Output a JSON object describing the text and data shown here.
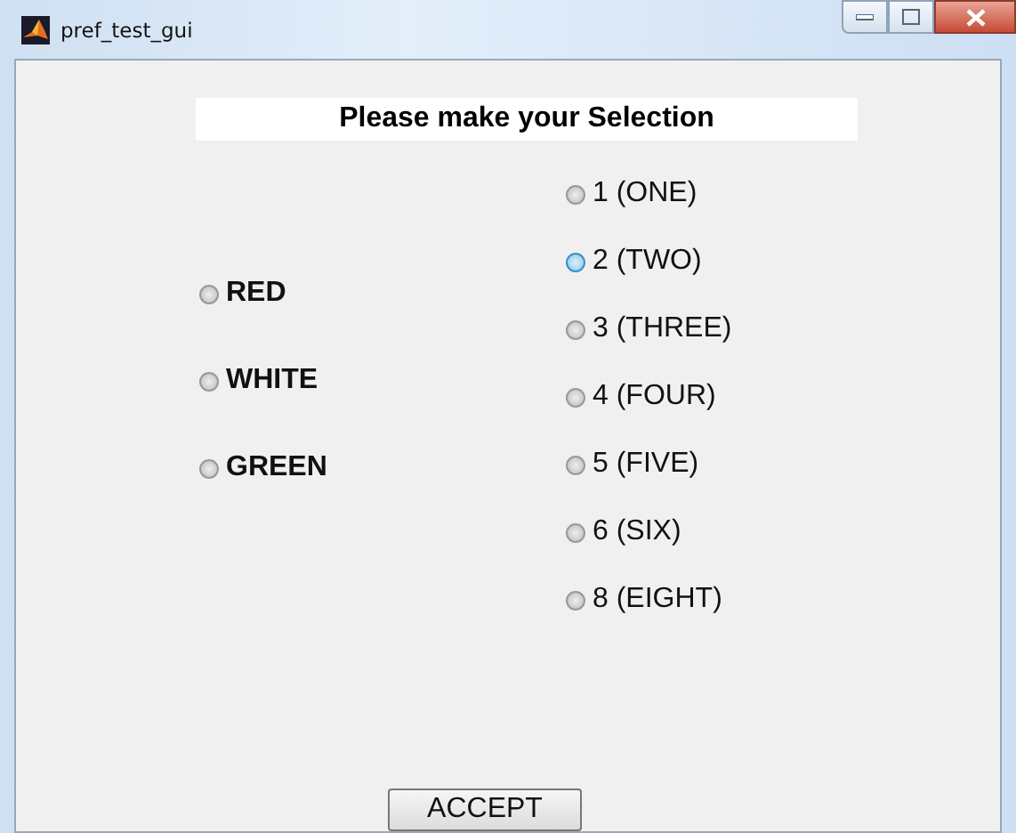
{
  "window": {
    "title": "pref_test_gui"
  },
  "heading": "Please make your Selection",
  "colors": [
    {
      "label": "RED",
      "selected": false
    },
    {
      "label": "WHITE",
      "selected": false
    },
    {
      "label": "GREEN",
      "selected": false
    }
  ],
  "numbers": [
    {
      "label": "1 (ONE)",
      "selected": false,
      "highlighted": false
    },
    {
      "label": "2 (TWO)",
      "selected": false,
      "highlighted": true
    },
    {
      "label": "3 (THREE)",
      "selected": false,
      "highlighted": false
    },
    {
      "label": "4 (FOUR)",
      "selected": false,
      "highlighted": false
    },
    {
      "label": "5 (FIVE)",
      "selected": false,
      "highlighted": false
    },
    {
      "label": "6 (SIX)",
      "selected": false,
      "highlighted": false
    },
    {
      "label": "8 (EIGHT)",
      "selected": false,
      "highlighted": false
    }
  ],
  "button": "ACCEPT"
}
